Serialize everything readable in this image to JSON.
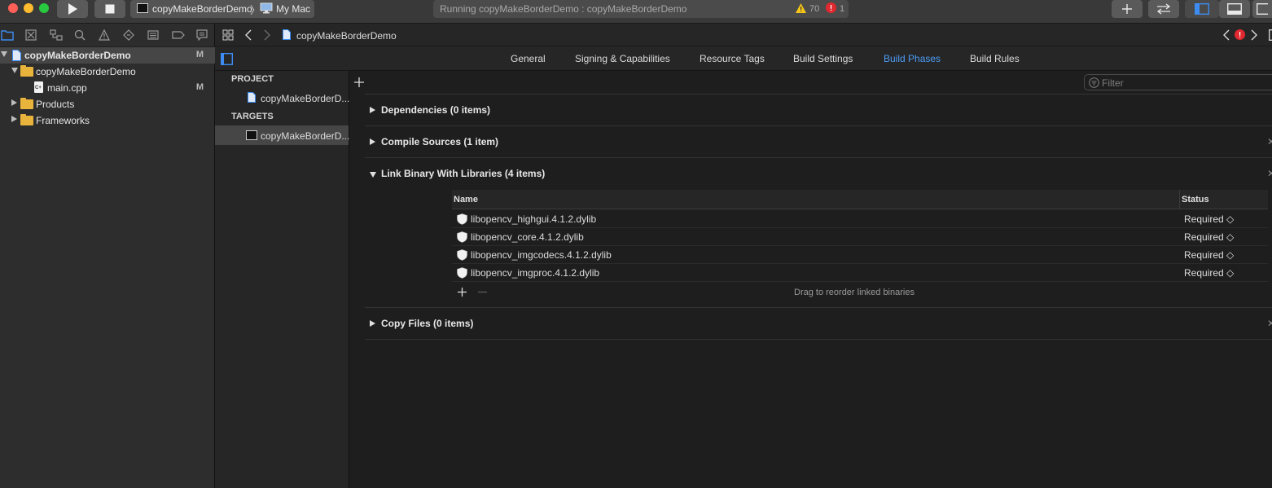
{
  "toolbar": {
    "scheme_name": "copyMakeBorderDemo",
    "destination": "My Mac",
    "status_text": "Running copyMakeBorderDemo : copyMakeBorderDemo",
    "warning_count": "70",
    "error_count": "1"
  },
  "navigator": {
    "items": [
      {
        "label": "copyMakeBorderDemo",
        "mark": "M"
      },
      {
        "label": "copyMakeBorderDemo",
        "mark": ""
      },
      {
        "label": "main.cpp",
        "mark": "M"
      },
      {
        "label": "Products",
        "mark": ""
      },
      {
        "label": "Frameworks",
        "mark": ""
      }
    ]
  },
  "jumpbar": {
    "file": "copyMakeBorderDemo"
  },
  "tabs": [
    {
      "label": "General"
    },
    {
      "label": "Signing & Capabilities"
    },
    {
      "label": "Resource Tags"
    },
    {
      "label": "Build Settings"
    },
    {
      "label": "Build Phases"
    },
    {
      "label": "Build Rules"
    }
  ],
  "targets": {
    "project_header": "PROJECT",
    "project_item": "copyMakeBorderD...",
    "targets_header": "TARGETS",
    "target_item": "copyMakeBorderD..."
  },
  "filter_placeholder": "Filter",
  "phases": [
    {
      "title": "Dependencies (0 items)"
    },
    {
      "title": "Compile Sources (1 item)"
    },
    {
      "title": "Link Binary With Libraries (4 items)"
    },
    {
      "title": "Copy Files (0 items)"
    }
  ],
  "libraries": {
    "col_name": "Name",
    "col_status": "Status",
    "rows": [
      {
        "name": "libopencv_highgui.4.1.2.dylib",
        "status": "Required ◇"
      },
      {
        "name": "libopencv_core.4.1.2.dylib",
        "status": "Required ◇"
      },
      {
        "name": "libopencv_imgcodecs.4.1.2.dylib",
        "status": "Required ◇"
      },
      {
        "name": "libopencv_imgproc.4.1.2.dylib",
        "status": "Required ◇"
      }
    ],
    "footer_hint": "Drag to reorder linked binaries"
  },
  "colors": {
    "accent": "#4d9cf5",
    "close": "#fe5f57",
    "minimize": "#febc2e",
    "zoom": "#28c840",
    "folder": "#e9b43b"
  }
}
